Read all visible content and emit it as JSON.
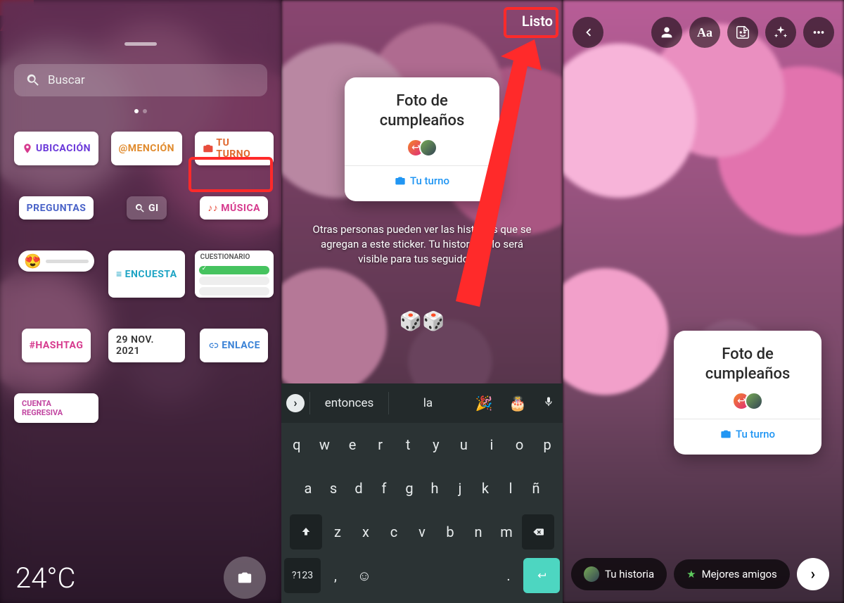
{
  "panel1": {
    "search_placeholder": "Buscar",
    "stickers": {
      "ubicacion": "UBICACIÓN",
      "mencion": "@MENCIÓN",
      "tu_turno": "TU TURNO",
      "preguntas": "PREGUNTAS",
      "gif": "GI",
      "musica": "MÚSICA",
      "encuesta": "ENCUESTA",
      "cuestionario": "CUESTIONARIO",
      "hashtag": "#HASHTAG",
      "date": "29 NOV. 2021",
      "enlace": "ENLACE",
      "cuenta_regresiva": "CUENTA REGRESIVA"
    },
    "temperature": "24°C"
  },
  "panel2": {
    "done_label": "Listo",
    "card_title": "Foto de cumpleaños",
    "card_cta": "Tu turno",
    "info_text": "Otras personas pueden ver las historias que se agregan a este sticker. Tu historia solo será visible para tus seguidores.",
    "dice": "🎲🎲",
    "keyboard": {
      "suggestions": [
        "entonces",
        "la"
      ],
      "emoji": [
        "🎉",
        "🎂"
      ],
      "row1": [
        "q",
        "w",
        "e",
        "r",
        "t",
        "y",
        "u",
        "i",
        "o",
        "p"
      ],
      "row2": [
        "a",
        "s",
        "d",
        "f",
        "g",
        "h",
        "j",
        "k",
        "l",
        "ñ"
      ],
      "row3": [
        "z",
        "x",
        "c",
        "v",
        "b",
        "n",
        "m"
      ],
      "sym": "?123",
      "comma": ",",
      "period": "."
    }
  },
  "panel3": {
    "card_title": "Foto de cumpleaños",
    "card_cta": "Tu turno",
    "share_story": "Tu historia",
    "share_friends": "Mejores amigos"
  }
}
